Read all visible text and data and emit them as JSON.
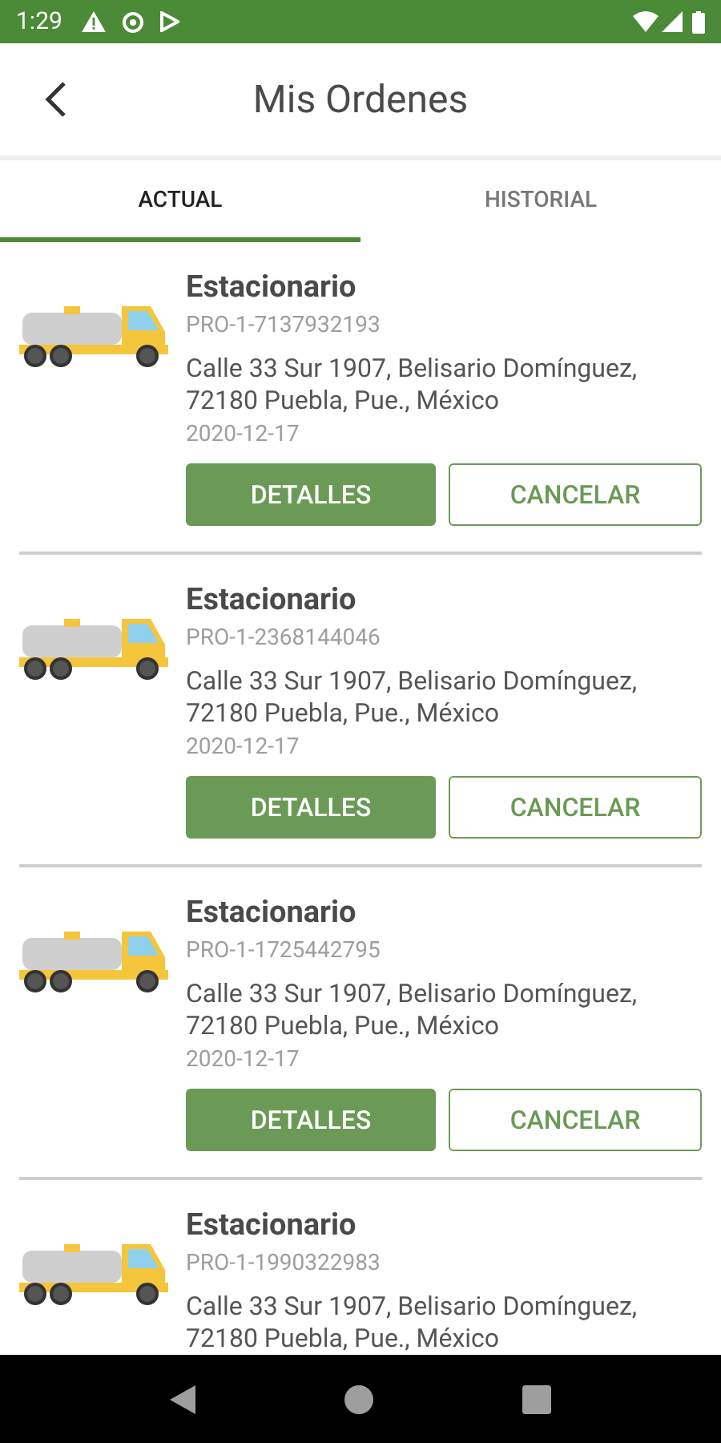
{
  "status_bar": {
    "time": "1:29"
  },
  "header": {
    "title": "Mis Ordenes"
  },
  "tabs": [
    {
      "label": "ACTUAL",
      "selected": true
    },
    {
      "label": "HISTORIAL",
      "selected": false
    }
  ],
  "orders": [
    {
      "title": "Estacionario",
      "code": "PRO-1-7137932193",
      "address": "Calle 33 Sur 1907, Belisario Domínguez, 72180 Puebla, Pue., México",
      "date": "2020-12-17",
      "buttons": [
        {
          "label": "DETALLES",
          "kind": "primary"
        },
        {
          "label": "CANCELAR",
          "kind": "outline"
        }
      ]
    },
    {
      "title": "Estacionario",
      "code": "PRO-1-2368144046",
      "address": "Calle 33 Sur 1907, Belisario Domínguez, 72180 Puebla, Pue., México",
      "date": "2020-12-17",
      "buttons": [
        {
          "label": "DETALLES",
          "kind": "primary"
        },
        {
          "label": "CANCELAR",
          "kind": "outline"
        }
      ]
    },
    {
      "title": "Estacionario",
      "code": "PRO-1-1725442795",
      "address": "Calle 33 Sur 1907, Belisario Domínguez, 72180 Puebla, Pue., México",
      "date": "2020-12-17",
      "buttons": [
        {
          "label": "DETALLES",
          "kind": "primary"
        },
        {
          "label": "CANCELAR",
          "kind": "outline"
        }
      ]
    },
    {
      "title": "Estacionario",
      "code": "PRO-1-1990322983",
      "address": "Calle 33 Sur 1907, Belisario Domínguez, 72180 Puebla, Pue., México"
    }
  ]
}
